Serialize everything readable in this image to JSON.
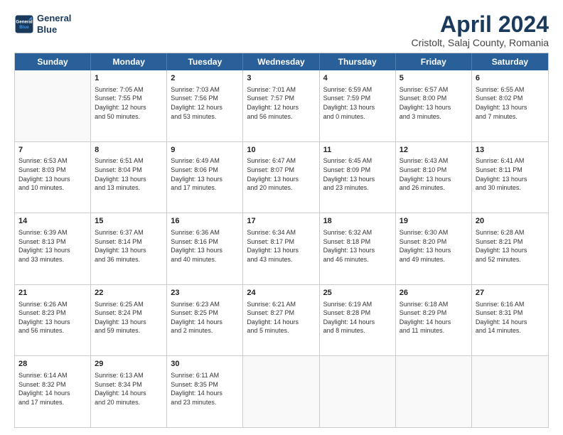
{
  "header": {
    "logo_line1": "General",
    "logo_line2": "Blue",
    "month": "April 2024",
    "location": "Cristolt, Salaj County, Romania"
  },
  "weekdays": [
    "Sunday",
    "Monday",
    "Tuesday",
    "Wednesday",
    "Thursday",
    "Friday",
    "Saturday"
  ],
  "rows": [
    [
      {
        "day": "",
        "text": ""
      },
      {
        "day": "1",
        "text": "Sunrise: 7:05 AM\nSunset: 7:55 PM\nDaylight: 12 hours\nand 50 minutes."
      },
      {
        "day": "2",
        "text": "Sunrise: 7:03 AM\nSunset: 7:56 PM\nDaylight: 12 hours\nand 53 minutes."
      },
      {
        "day": "3",
        "text": "Sunrise: 7:01 AM\nSunset: 7:57 PM\nDaylight: 12 hours\nand 56 minutes."
      },
      {
        "day": "4",
        "text": "Sunrise: 6:59 AM\nSunset: 7:59 PM\nDaylight: 13 hours\nand 0 minutes."
      },
      {
        "day": "5",
        "text": "Sunrise: 6:57 AM\nSunset: 8:00 PM\nDaylight: 13 hours\nand 3 minutes."
      },
      {
        "day": "6",
        "text": "Sunrise: 6:55 AM\nSunset: 8:02 PM\nDaylight: 13 hours\nand 7 minutes."
      }
    ],
    [
      {
        "day": "7",
        "text": "Sunrise: 6:53 AM\nSunset: 8:03 PM\nDaylight: 13 hours\nand 10 minutes."
      },
      {
        "day": "8",
        "text": "Sunrise: 6:51 AM\nSunset: 8:04 PM\nDaylight: 13 hours\nand 13 minutes."
      },
      {
        "day": "9",
        "text": "Sunrise: 6:49 AM\nSunset: 8:06 PM\nDaylight: 13 hours\nand 17 minutes."
      },
      {
        "day": "10",
        "text": "Sunrise: 6:47 AM\nSunset: 8:07 PM\nDaylight: 13 hours\nand 20 minutes."
      },
      {
        "day": "11",
        "text": "Sunrise: 6:45 AM\nSunset: 8:09 PM\nDaylight: 13 hours\nand 23 minutes."
      },
      {
        "day": "12",
        "text": "Sunrise: 6:43 AM\nSunset: 8:10 PM\nDaylight: 13 hours\nand 26 minutes."
      },
      {
        "day": "13",
        "text": "Sunrise: 6:41 AM\nSunset: 8:11 PM\nDaylight: 13 hours\nand 30 minutes."
      }
    ],
    [
      {
        "day": "14",
        "text": "Sunrise: 6:39 AM\nSunset: 8:13 PM\nDaylight: 13 hours\nand 33 minutes."
      },
      {
        "day": "15",
        "text": "Sunrise: 6:37 AM\nSunset: 8:14 PM\nDaylight: 13 hours\nand 36 minutes."
      },
      {
        "day": "16",
        "text": "Sunrise: 6:36 AM\nSunset: 8:16 PM\nDaylight: 13 hours\nand 40 minutes."
      },
      {
        "day": "17",
        "text": "Sunrise: 6:34 AM\nSunset: 8:17 PM\nDaylight: 13 hours\nand 43 minutes."
      },
      {
        "day": "18",
        "text": "Sunrise: 6:32 AM\nSunset: 8:18 PM\nDaylight: 13 hours\nand 46 minutes."
      },
      {
        "day": "19",
        "text": "Sunrise: 6:30 AM\nSunset: 8:20 PM\nDaylight: 13 hours\nand 49 minutes."
      },
      {
        "day": "20",
        "text": "Sunrise: 6:28 AM\nSunset: 8:21 PM\nDaylight: 13 hours\nand 52 minutes."
      }
    ],
    [
      {
        "day": "21",
        "text": "Sunrise: 6:26 AM\nSunset: 8:23 PM\nDaylight: 13 hours\nand 56 minutes."
      },
      {
        "day": "22",
        "text": "Sunrise: 6:25 AM\nSunset: 8:24 PM\nDaylight: 13 hours\nand 59 minutes."
      },
      {
        "day": "23",
        "text": "Sunrise: 6:23 AM\nSunset: 8:25 PM\nDaylight: 14 hours\nand 2 minutes."
      },
      {
        "day": "24",
        "text": "Sunrise: 6:21 AM\nSunset: 8:27 PM\nDaylight: 14 hours\nand 5 minutes."
      },
      {
        "day": "25",
        "text": "Sunrise: 6:19 AM\nSunset: 8:28 PM\nDaylight: 14 hours\nand 8 minutes."
      },
      {
        "day": "26",
        "text": "Sunrise: 6:18 AM\nSunset: 8:29 PM\nDaylight: 14 hours\nand 11 minutes."
      },
      {
        "day": "27",
        "text": "Sunrise: 6:16 AM\nSunset: 8:31 PM\nDaylight: 14 hours\nand 14 minutes."
      }
    ],
    [
      {
        "day": "28",
        "text": "Sunrise: 6:14 AM\nSunset: 8:32 PM\nDaylight: 14 hours\nand 17 minutes."
      },
      {
        "day": "29",
        "text": "Sunrise: 6:13 AM\nSunset: 8:34 PM\nDaylight: 14 hours\nand 20 minutes."
      },
      {
        "day": "30",
        "text": "Sunrise: 6:11 AM\nSunset: 8:35 PM\nDaylight: 14 hours\nand 23 minutes."
      },
      {
        "day": "",
        "text": ""
      },
      {
        "day": "",
        "text": ""
      },
      {
        "day": "",
        "text": ""
      },
      {
        "day": "",
        "text": ""
      }
    ]
  ]
}
